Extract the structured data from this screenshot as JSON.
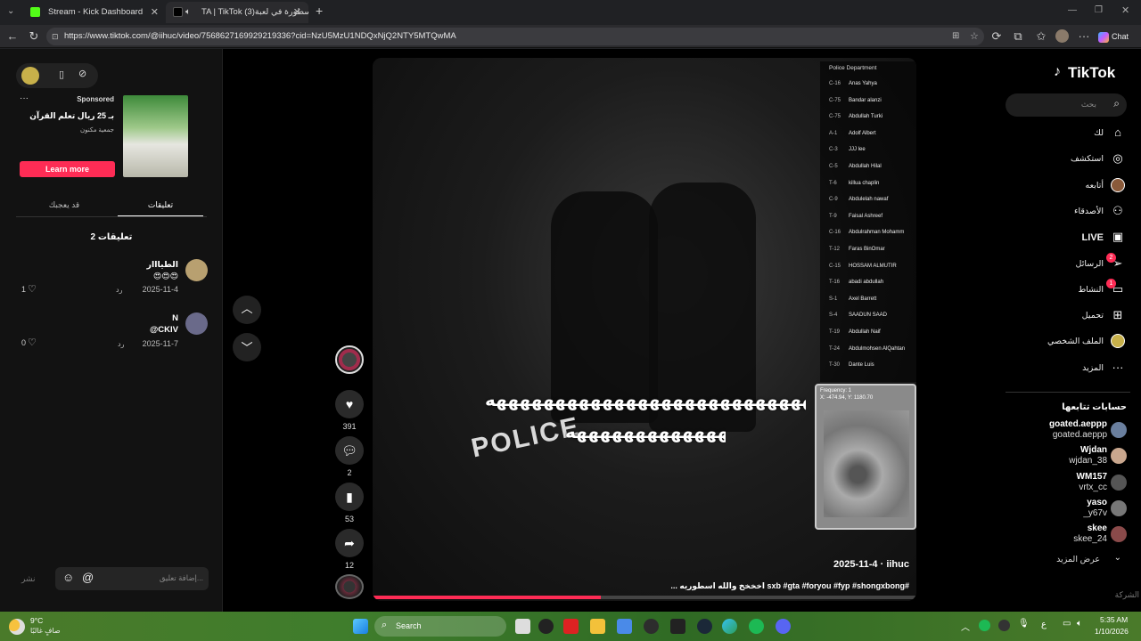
{
  "tabs": [
    {
      "title": "Stream - Kick Dashboard",
      "color": "#53fc18"
    },
    {
      "title": "TA | TikTok ‏أسطورة في لعبة(3)",
      "color": "#000000"
    }
  ],
  "address": {
    "url": "https://www.tiktok.com/@iihuc/video/7568627169929219336?cid=NzU5MzU1NDQxNjQ2NTY5MTQwMA",
    "chat_label": "Chat"
  },
  "ad": {
    "sponsored": "Sponsored",
    "text": "بـ 25 ريال تعلم القرآن",
    "org": "جمعية مكنون",
    "button": "Learn more",
    "dots": "···"
  },
  "panel_tabs": {
    "comments": "تعليقات",
    "liked": "قد يعجبك"
  },
  "comments_count": "2 تعليقات",
  "comments": [
    {
      "user": "الطيااار",
      "text": "😍😍😍",
      "date": "2025-11-4",
      "reply": "رد",
      "likes": "1"
    },
    {
      "user": "N",
      "text": "@CKIV",
      "date": "2025-11-7",
      "reply": "رد",
      "likes": "0"
    }
  ],
  "comment_input": {
    "placeholder": "إضافة تعليق...",
    "post": "نشر"
  },
  "actions": {
    "likes": "391",
    "comments": "2",
    "saves": "53",
    "shares": "12"
  },
  "video": {
    "date_user": "2025-11-4 · iihuc",
    "caption": "#sxb #gta #foryou #fyp #shongxbong اخخخخ والله اسطوريه ...",
    "overlay_line1": "ههههههههههههههههههههههههههههه",
    "overlay_line2": "ههههههههههههههههه",
    "police_text": "POLICE",
    "pd_title": "Police Department",
    "pd_rows": [
      {
        "code": "C-16",
        "name": "Anas Yahya"
      },
      {
        "code": "C-75",
        "name": "Bandar alanzi"
      },
      {
        "code": "C-75",
        "name": "Abdullah Turki"
      },
      {
        "code": "A-1",
        "name": "Adolf Albert"
      },
      {
        "code": "C-3",
        "name": "JJJ lee"
      },
      {
        "code": "C-5",
        "name": "Abdullah Hilal"
      },
      {
        "code": "T-6",
        "name": "killua chaplin"
      },
      {
        "code": "C-9",
        "name": "Abdulelah nawaf"
      },
      {
        "code": "T-9",
        "name": "Faisal Ashreef"
      },
      {
        "code": "C-16",
        "name": "Abdulrahman Mohamm"
      },
      {
        "code": "T-12",
        "name": "Faras BinOmar"
      },
      {
        "code": "C-15",
        "name": "HOSSAM ALMUTIR"
      },
      {
        "code": "T-16",
        "name": "abadi abdullah"
      },
      {
        "code": "S-1",
        "name": "Axel Barrett"
      },
      {
        "code": "S-4",
        "name": "SAADUN SAAD"
      },
      {
        "code": "T-19",
        "name": "Abdullah Naif"
      },
      {
        "code": "T-24",
        "name": "Abdulmohsen AlQahtan"
      },
      {
        "code": "T-30",
        "name": "Dante Luis"
      }
    ],
    "map_label": "Frequency: 1",
    "map_coords": "X: -474.94, Y: 1180.70"
  },
  "brand": "TikTok",
  "search_placeholder": "بحث",
  "nav": [
    {
      "label": "لك",
      "icon": "home-icon"
    },
    {
      "label": "استكشف",
      "icon": "compass-icon"
    },
    {
      "label": "أتابعه",
      "icon": "following-avatar-icon"
    },
    {
      "label": "الأصدقاء",
      "icon": "friends-icon"
    },
    {
      "label": "LIVE",
      "icon": "live-icon"
    },
    {
      "label": "الرسائل",
      "icon": "messages-icon",
      "badge": "2"
    },
    {
      "label": "النشاط",
      "icon": "activity-icon",
      "badge": "1"
    },
    {
      "label": "تحميل",
      "icon": "upload-icon"
    },
    {
      "label": "الملف الشخصي",
      "icon": "profile-icon"
    },
    {
      "label": "المزيد",
      "icon": "more-icon"
    }
  ],
  "following_title": "حسابات تتابعها",
  "following": [
    {
      "name": "goated.aeppp",
      "handle": "goated.aeppp",
      "color": "#6a7f9e"
    },
    {
      "name": "Wjdan",
      "handle": "wjdan_38",
      "color": "#c9a78e"
    },
    {
      "name": "WM157",
      "handle": "vrtx_cc",
      "color": "#555555"
    },
    {
      "name": "yaso",
      "handle": "_y67v",
      "color": "#777777"
    },
    {
      "name": "skee",
      "handle": "skee_24",
      "color": "#8a4a4a"
    }
  ],
  "show_more": "عرض المزيد",
  "company": "الشركة",
  "taskbar": {
    "weather_temp": "9°C",
    "weather_desc": "صافٍ غالبًا",
    "search": "Search",
    "lang": "ع",
    "time": "5:35 AM",
    "date": "1/10/2026"
  }
}
